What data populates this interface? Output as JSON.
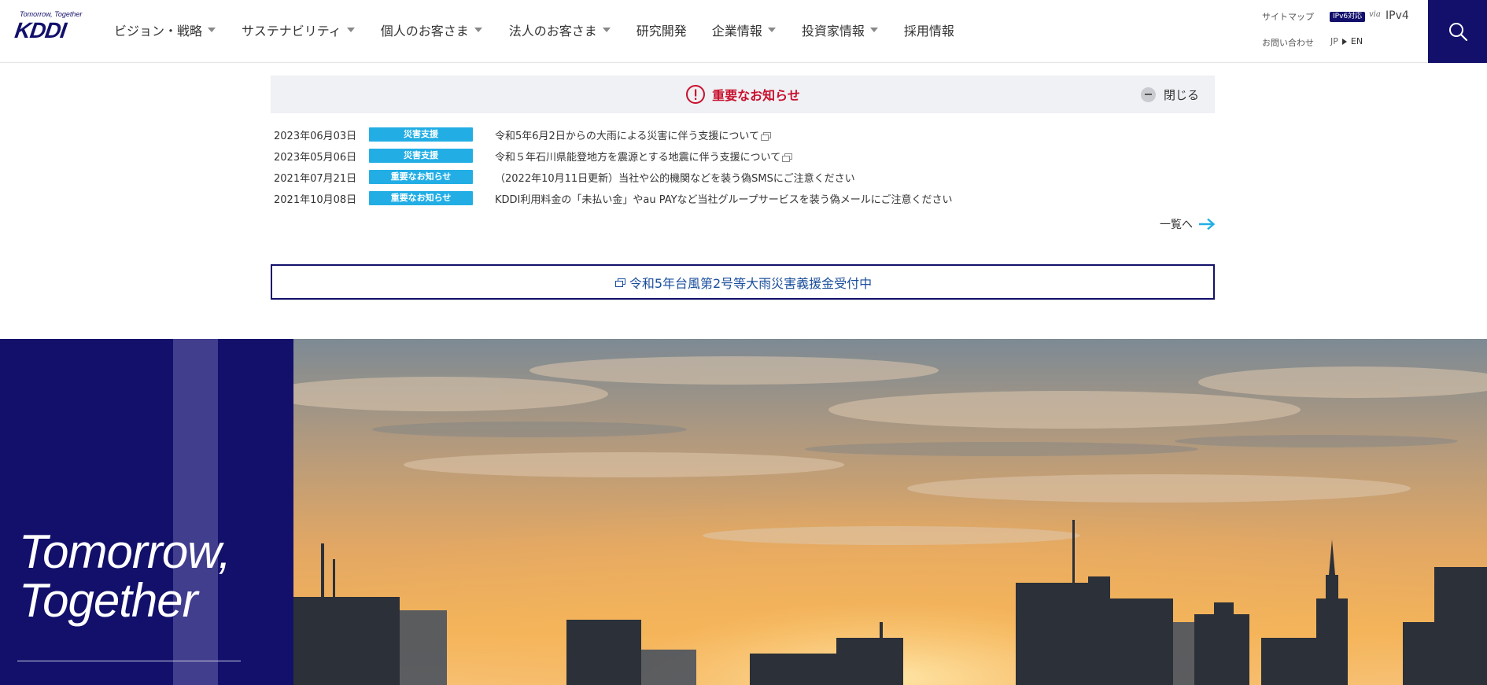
{
  "header": {
    "logo": {
      "tagline": "Tomorrow, Together",
      "wordmark": "KDDI"
    },
    "nav": [
      {
        "label": "ビジョン・戦略",
        "has_dropdown": true
      },
      {
        "label": "サステナビリティ",
        "has_dropdown": true
      },
      {
        "label": "個人のお客さま",
        "has_dropdown": true
      },
      {
        "label": "法人のお客さま",
        "has_dropdown": true
      },
      {
        "label": "研究開発",
        "has_dropdown": false
      },
      {
        "label": "企業情報",
        "has_dropdown": true
      },
      {
        "label": "投資家情報",
        "has_dropdown": true
      },
      {
        "label": "採用情報",
        "has_dropdown": false
      }
    ],
    "util": {
      "sitemap": "サイトマップ",
      "contact": "お問い合わせ",
      "ipv6_badge": "IPv6対応",
      "via": "via",
      "ipv4": "IPv4",
      "lang_jp": "JP",
      "lang_en": "EN"
    },
    "search_icon": "search-icon"
  },
  "notice": {
    "title": "重要なお知らせ",
    "close_label": "閉じる",
    "items": [
      {
        "date": "2023年06月03日",
        "tag": "災害支援",
        "text": "令和5年6月2日からの大雨による災害に伴う支援について",
        "external": true
      },
      {
        "date": "2023年05月06日",
        "tag": "災害支援",
        "text": "令和５年石川県能登地方を震源とする地震に伴う支援について",
        "external": true
      },
      {
        "date": "2021年07月21日",
        "tag": "重要なお知らせ",
        "text": "（2022年10月11日更新）当社や公的機関などを装う偽SMSにご注意ください",
        "external": false
      },
      {
        "date": "2021年10月08日",
        "tag": "重要なお知らせ",
        "text": "KDDI利用料金の「未払い金」やau PAYなど当社グループサービスを装う偽メールにご注意ください",
        "external": false
      }
    ],
    "more_label": "一覧へ"
  },
  "donation": {
    "label": "令和5年台風第2号等大雨災害義援金受付中"
  },
  "hero": {
    "line1": "Tomorrow,",
    "line2": "Together"
  },
  "colors": {
    "brand_navy": "#12106b",
    "tag_blue": "#22aee5",
    "alert_red": "#c8102e",
    "link_blue": "#1a4e9c"
  }
}
